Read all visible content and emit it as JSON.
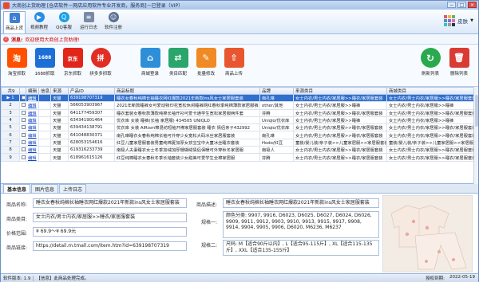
{
  "window": {
    "title": "大商创上货助理 [仓店软件－网店应用软件专业开发商，服务商]－已登录（VIP）",
    "controls": [
      "−",
      "□",
      "×"
    ]
  },
  "toolbar": {
    "items": [
      {
        "label": "商品上货",
        "icon": "shop-icon",
        "color": "#3e7fd6"
      },
      {
        "label": "视频教程",
        "icon": "play-icon",
        "color": "#2b8be0"
      },
      {
        "label": "QQ客服",
        "icon": "qq-icon",
        "color": "#1aa0e8"
      },
      {
        "label": "运行日志",
        "icon": "log-icon",
        "color": "#7a8aa6"
      },
      {
        "label": "软件注册",
        "icon": "user-icon",
        "color": "#5a6f93"
      }
    ],
    "skin_label": "皮肤"
  },
  "message": {
    "label": "消息:",
    "text": "欢迎使用大商创上货助理!"
  },
  "platforms": [
    {
      "label": "淘宝抓取",
      "badge": "淘",
      "color": "#ff5000"
    },
    {
      "label": "1688抓取",
      "badge": "1688",
      "color": "#1d6fd6"
    },
    {
      "label": "京东抓取",
      "badge": "京东",
      "color": "#e1251b"
    },
    {
      "label": "拼多多抓取",
      "badge": "拼",
      "color": "#e02e24"
    }
  ],
  "actions": [
    {
      "label": "商城登录",
      "icon": "store-icon",
      "color": "#2e8fd8"
    },
    {
      "label": "类目匹配",
      "icon": "match-icon",
      "color": "#2aa56b"
    },
    {
      "label": "批量修改",
      "icon": "edit-icon",
      "color": "#f08a24"
    },
    {
      "label": "商品上传",
      "icon": "upload-icon",
      "color": "#e8562f"
    }
  ],
  "right_actions": [
    {
      "label": "刷新列表",
      "icon": "refresh-icon",
      "color": "#2aa94f"
    },
    {
      "label": "删除列表",
      "icon": "delete-icon",
      "color": "#d93b34"
    }
  ],
  "grid": {
    "columns": [
      "共9",
      "编辑",
      "信息",
      "来源",
      "产品ID",
      "商品标题",
      "品牌",
      "来源类目",
      "商城类目"
    ],
    "rows": [
      {
        "n": "1",
        "edit": "编辑",
        "source": "天猫",
        "id": "639198707319",
        "title": "睡衣女春秋纯棉长袖睡衣网红爆款2021年新款ins风女士家居服套装",
        "brand": "南孔琳",
        "src_cat": "女士内衣/男士内衣/家居服>>睡衣/家居服套装",
        "mall_cat": "女士内衣/男士内衣/家居服>>睡衣/家居服套装",
        "selected": true
      },
      {
        "n": "2",
        "edit": "编辑",
        "source": "天猫",
        "id": "566053903967",
        "title": "2021年新款睡裤女可爱动物印花宽松休闲睡裤网红春秋季纯棉薄款家居服裤",
        "brand": "other/其他",
        "src_cat": "女士内衣/男士内衣/家居服>>睡裤",
        "mall_cat": "女士内衣/男士内衣/家居服>>睡裤"
      },
      {
        "n": "3",
        "edit": "编辑",
        "source": "天猫",
        "id": "641177459307",
        "title": "睡衣套装女春秋款薄款纯棉长袖开衫可爱卡通学生宽松家居服两件套",
        "brand": "芬腾",
        "src_cat": "女士内衣/男士内衣/家居服>>睡衣/家居服套装",
        "mall_cat": "女士内衣/男士内衣/家居服>>睡衣/家居服套装"
      },
      {
        "n": "4",
        "edit": "编辑",
        "source": "天猫",
        "id": "634341901464",
        "title": "优衣库 女装 睡裤(长袖 家居服) 434505 UNIQLO",
        "brand": "Uniqlo/优衣库",
        "src_cat": "女士内衣/男士内衣/家居服>>睡裤",
        "mall_cat": "女士内衣/男士内衣/家居服>>睡裤"
      },
      {
        "n": "5",
        "edit": "编辑",
        "source": "天猫",
        "id": "639434138791",
        "title": "优衣库 女装 AIRism棉混纺短袖开襟家居服套装 睡衣 情侣亲子432992",
        "brand": "Uniqlo/优衣库",
        "src_cat": "女士内衣/男士内衣/家居服>>睡衣/家居服套装",
        "mall_cat": "女士内衣/男士内衣/家居服>>睡衣/家居服套装"
      },
      {
        "n": "6",
        "edit": "编辑",
        "source": "天猫",
        "id": "641048830371",
        "title": "南孔琳睡衣女春秋纯棉长袖可外穿少女宽松大码冰丝家居服套装",
        "brand": "南孔琳",
        "src_cat": "女士内衣/男士内衣/家居服>>睡衣/家居服套装",
        "mall_cat": "女士内衣/男士内衣/家居服>>睡衣/家居服套装"
      },
      {
        "n": "7",
        "edit": "编辑",
        "source": "天猫",
        "id": "628053154616",
        "title": "红豆儿童家居服套装男童纯棉夏加厚女孩宝宝中大童冰丝睡衣套装",
        "brand": "Hodo/红豆",
        "src_cat": "童装/婴儿装/亲子装>>儿童家居服>>家居服套装",
        "mall_cat": "童装/婴儿装/亲子装>>儿童家居服>>家居服套装"
      },
      {
        "n": "8",
        "edit": "编辑",
        "source": "天猫",
        "id": "619316233739",
        "title": "南极人夫妻睡衣女士冬季加绒加厚珊瑚绒情侣保暖可外穿秋冬家居服",
        "brand": "南极人",
        "src_cat": "女士内衣/男士内衣/家居服>>睡衣/家居服套装",
        "mall_cat": "女士内衣/男士内衣/家居服>>睡衣/家居服套装"
      },
      {
        "n": "9",
        "edit": "编辑",
        "source": "天猫",
        "id": "618961615126",
        "title": "红豆纯棉睡衣女春秋冬季长袖套装少女甜美可爱学生全棉家居服",
        "brand": "芬腾",
        "src_cat": "女士内衣/男士内衣/家居服>>睡衣/家居服套装",
        "mall_cat": "女士内衣/男士内衣/家居服>>睡衣/家居服套装"
      }
    ]
  },
  "tabs": [
    "基本信息",
    "图片信息",
    "上传日志"
  ],
  "detail": {
    "name_label": "商品名称:",
    "name": "睡衣女春秋纯棉长袖睡衣网红爆款2021年新款ins风女士家居服套装",
    "cat_label": "商品类目:",
    "cat": "女士内衣/男士内衣/家居服>>睡衣/家居服套装",
    "price_label": "价格范围:",
    "price": "¥ 69.9～¥ 69.9元",
    "link_label": "商品链接:",
    "link": "https://detail.m.tmall.com/item.htm?id=639198707319",
    "desc_label": "商品描述:",
    "desc": "睡衣女春秋纯棉长袖睡衣网红爆款2021年新款ins风女士家居服套装",
    "spec1_label": "规格一:",
    "spec1": "颜色分类: 9907, 9916, D6023, D6025, D6027, D6024, D6026, 9909, 9911, 9912, 9903, 9910, 9913, 9915, 9917, 9908, 9914, 9904, 9905, 9906, D6020, M6236, M6237",
    "spec2_label": "规格二:",
    "spec2": "尺码: M【适合90斤以内】, L【适合95-115斤】, XL【适合115-135斤】, XXL【适合135-155斤】"
  },
  "status": {
    "version_label": "软件版本: 1.9",
    "info_label": "【信息】此商品处理完成。",
    "expiry_label": "授权到期:",
    "expiry": "2022-05-19"
  }
}
